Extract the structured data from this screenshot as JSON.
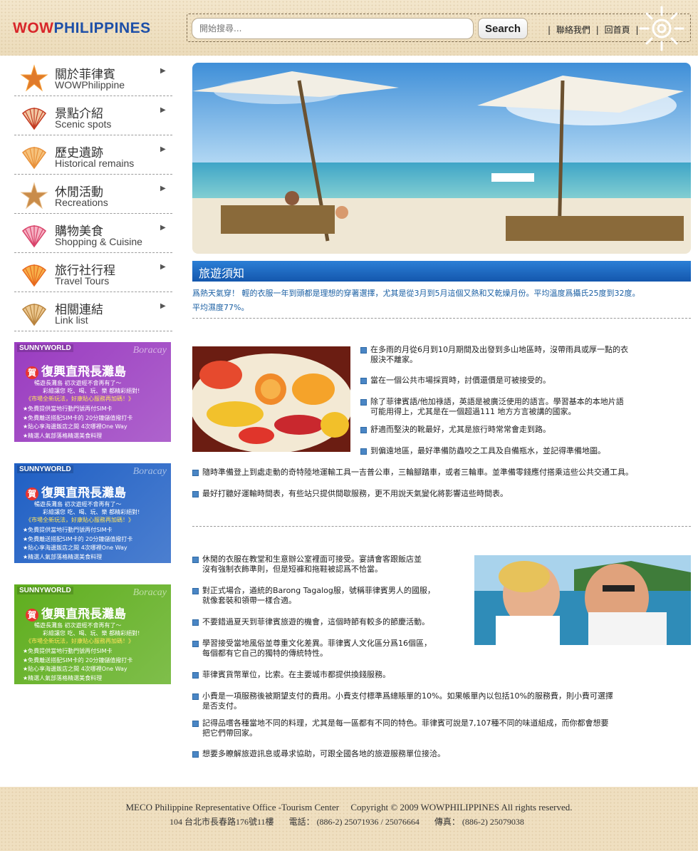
{
  "header": {
    "logo_wow": "WOW",
    "logo_phil": "PHILIPPINES",
    "search_placeholder": "開始搜尋...",
    "search_button": "Search",
    "link_contact": "聯絡我們",
    "link_home": "回首頁",
    "separator": "|"
  },
  "sidebar": {
    "items": [
      {
        "zh": "關於菲律賓",
        "en": "WOWPhilippine",
        "icon": "starfish-icon"
      },
      {
        "zh": "景點介紹",
        "en": "Scenic spots",
        "icon": "scallop-shell-icon"
      },
      {
        "zh": "歷史遺跡",
        "en": "Historical remains",
        "icon": "scallop-shell-icon"
      },
      {
        "zh": "休閒活動",
        "en": "Recreations",
        "icon": "starfish-icon"
      },
      {
        "zh": "購物美食",
        "en": "Shopping & Cuisine",
        "icon": "scallop-shell-icon"
      },
      {
        "zh": "旅行社行程",
        "en": "Travel Tours",
        "icon": "scallop-shell-icon"
      },
      {
        "zh": "相關連結",
        "en": "Link list",
        "icon": "scallop-shell-icon"
      }
    ],
    "arrow": "▶",
    "ads": [
      {
        "brand": "SUNNYWORLD",
        "place": "Boracay",
        "ga": "賀",
        "title": "復興直飛長灘島",
        "l1": "暢遊長灘島 初次遊經不會再有了～",
        "l2": "彩繪讓您 吃、喝、玩、樂 都精彩絕對!",
        "l3": "《市場全新玩法，好康貼心服務再加碼！》",
        "list": [
          "★免費提供當地行動門號再付SIM卡",
          "★免費離送搭配SIM卡的 20分鐘儲值撥打卡",
          "★貼心享海邊飯店之間 4次哪裡One Way",
          "★精選人氣部落格精選美食料理"
        ],
        "color": "#9a3cc0"
      },
      {
        "brand": "SUNNYWORLD",
        "place": "Boracay",
        "ga": "賀",
        "title": "復興直飛長灘島",
        "l1": "暢遊長灘島 初次遊經不會再有了～",
        "l2": "彩繪讓您 吃、喝、玩、樂 都精彩絕對!",
        "l3": "《市場全新玩法，好康貼心服務再加碼！》",
        "list": [
          "★免費提供當地行動門號再付SIM卡",
          "★免費離送搭配SIM卡的 20分鐘儲值撥打卡",
          "★貼心享海邊飯店之間 4次哪裡One Way",
          "★精選人氣部落格精選美食料理"
        ],
        "color": "#1f5fc4"
      },
      {
        "brand": "SUNNYWORLD",
        "place": "Boracay",
        "ga": "賀",
        "title": "復興直飛長灘島",
        "l1": "暢遊長灘島 初次遊經不會再有了～",
        "l2": "彩繪讓您 吃、喝、玩、樂 都精彩絕對!",
        "l3": "《市場全新玩法，好康貼心服務再加碼！》",
        "list": [
          "★免費提供當地行動門號再付SIM卡",
          "★免費離送搭配SIM卡的 20分鐘儲值撥打卡",
          "★貼心享海邊飯店之間 4次哪裡One Way",
          "★精選人氣部落格精選美食料理"
        ],
        "color": "#5fae1e"
      }
    ]
  },
  "main": {
    "section_title": "旅遊須知",
    "intro_line1": "爲熱天氣穿！ 輕的衣服一年到頭都是理想的穿著選擇，尤其是從3月到5月這個又熱和又乾燥月份。平均溫度爲攝氏25度到32度。",
    "intro_line2": "平均濕度77%。",
    "block1": [
      [
        "在多雨的月從6月到10月期間及出發到多山地區時，沒帶雨具或厚一點的衣",
        "服決不離家。"
      ],
      [
        "當在一個公共市場採買時，討價還價是可被接受的。"
      ],
      [
        "除了菲律賓語/他加祿語，英語是被廣泛使用的語言。學習基本的本地片語",
        "可能用得上，尤其是在一個超過111 地方方言被講的國家。"
      ],
      [
        "舒適而堅決的靴最好，尤其是旅行時常常會走到路。"
      ],
      [
        "到偏遠地區，最好準備防蟲咬之工具及自備瓶水，並記得準備地圖。"
      ]
    ],
    "block1_wide": [
      "隨時準備登上到處走動的奇特陸地運輸工具一吉普公車，三輪腳踏車，或者三輪車。並準備零錢應付搭乘這些公共交通工具。",
      "最好打聽好運輸時間表，有些站只提供間歇服務，更不用說天氣變化將影響這些時間表。"
    ],
    "block2": [
      [
        "休閒的衣服在教堂和生意辦公室裡面可接受。宴請會客跟飯店並",
        "沒有強制衣飾準則，但是短褲和拖鞋被認爲不恰當。"
      ],
      [
        "對正式場合，遒統的Barong Tagalog服，號稱菲律賓男人的國服，",
        "就像套裝和領帶一樣合適。"
      ],
      [
        "不要錯過夏天到菲律賓旅遊的機會，這個時節有較多的節慶活動。"
      ],
      [
        "學習接受當地風俗並尊重文化差異。菲律賓人文化區分爲16個區，",
        "每個都有它自己的獨特的傳統特性。"
      ]
    ],
    "block2_wide": [
      [
        "菲律賓貨幣單位，比索。在主要城市都提供換錢服務。"
      ],
      [
        "小費是一項服務後被期望支付的費用。小費支付標準爲總賬單的10%。如果帳單內以包括10%的服務費，則小費可選擇",
        "是否支付。"
      ],
      [
        "記得品嚐各種當地不同的料理，尤其是每一區都有不同的特色。菲律賓可說是7,107種不同的味道組成，而你都會想要",
        "把它們帶回家。"
      ],
      [
        "想要多瞭解旅遊訊息或尋求協助，可跟全國各地的旅遊服務單位接洽。"
      ]
    ]
  },
  "footer": {
    "line1": "MECO Philippine Representative Office -Tourism Center　 Copyright © 2009 WOWPHILIPPINES All rights reserved.",
    "address": "104 台北市長春路176號11樓",
    "phone": "電話： (886-2) 25071936 / 25076664",
    "fax": "傳真： (886-2) 25079038"
  }
}
